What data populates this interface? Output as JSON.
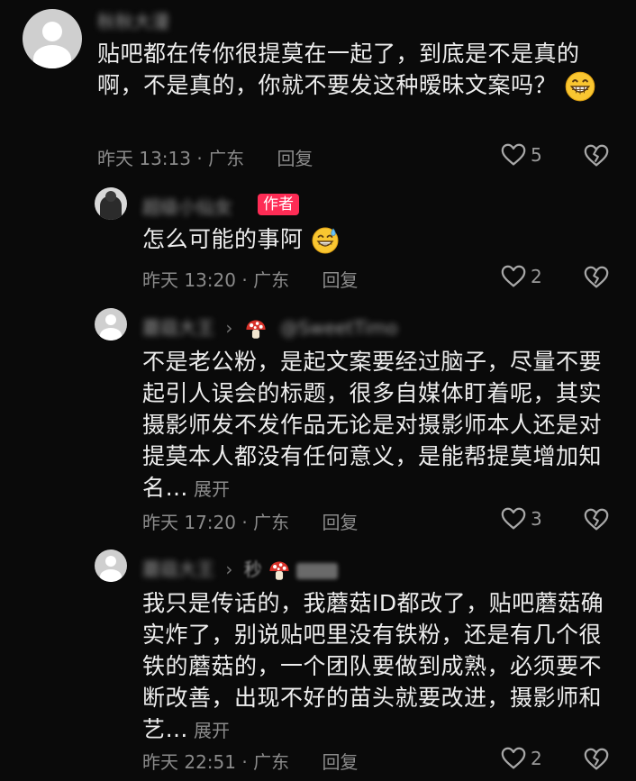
{
  "comments": [
    {
      "username": "秋秋大漫",
      "text": "贴吧都在传你很提莫在一起了，到底是不是真的啊，不是真的，你就不要发这种暧昧文案吗？",
      "meta": "昨天 13:13 · 广东",
      "reply_label": "回复",
      "likes": "5"
    },
    {
      "username": "超级小仙女",
      "author_badge": "作者",
      "text": "怎么可能的事阿",
      "meta": "昨天 13:20 · 广东",
      "reply_label": "回复",
      "likes": "2"
    },
    {
      "username": "蘑菇大王",
      "reply_target": "@SweetTimo",
      "text": "不是老公粉，是起文案要经过脑子，尽量不要起引人误会的标题，很多自媒体盯着呢，其实摄影师发不发作品无论是对摄影师本人还是对提莫本人都没有任何意义，是能帮提莫增加知名…",
      "expand_label": "展开",
      "meta": "昨天 17:20 · 广东",
      "reply_label": "回复",
      "likes": "3"
    },
    {
      "username": "蘑菇大王",
      "reply_target": "秒",
      "text": "我只是传话的，我蘑菇ID都改了，贴吧蘑菇确实炸了，别说贴吧里没有铁粉，还是有几个很铁的蘑菇的，一个团队要做到成熟，必须要不断改善，出现不好的苗头就要改进，摄影师和艺…",
      "expand_label": "展开",
      "meta": "昨天 22:51 · 广东",
      "reply_label": "回复",
      "likes": "2"
    }
  ],
  "icons": {
    "like": "heart-outline-icon",
    "dislike": "broken-heart-icon",
    "mushroom": "mushroom-icon",
    "grin": "grin-emoji-icon",
    "sweat": "sweat-smile-emoji-icon"
  },
  "colors": {
    "background": "#0a0a0a",
    "author_badge": "#fe2c55"
  }
}
